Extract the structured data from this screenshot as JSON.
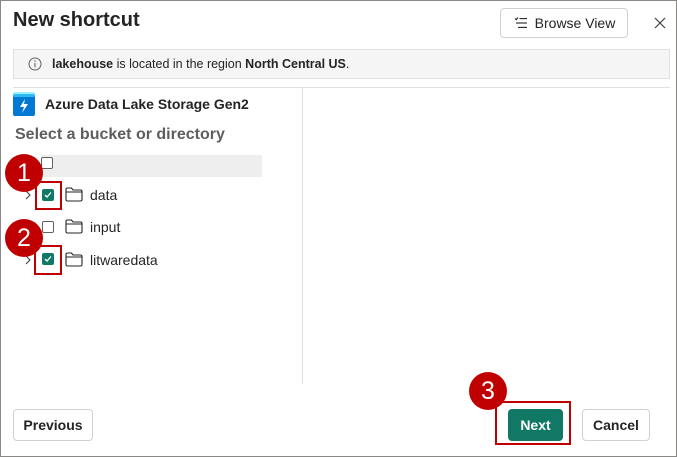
{
  "dialog": {
    "title": "New shortcut",
    "browse_view_label": "Browse View"
  },
  "info": {
    "lakehouse": "lakehouse",
    "message_middle": " is located in the region ",
    "region": "North Central US",
    "message_end": "."
  },
  "source": {
    "name": "Azure Data Lake Storage Gen2"
  },
  "tree": {
    "section_label": "Select a bucket or directory",
    "items": [
      {
        "label": "data",
        "checked": true
      },
      {
        "label": "input",
        "checked": false
      },
      {
        "label": "litwaredata",
        "checked": true
      }
    ]
  },
  "annotations": {
    "step1": "1",
    "step2": "2",
    "step3": "3",
    "color": "#c00000"
  },
  "footer": {
    "previous_label": "Previous",
    "next_label": "Next",
    "cancel_label": "Cancel"
  },
  "colors": {
    "accent": "#117865"
  }
}
